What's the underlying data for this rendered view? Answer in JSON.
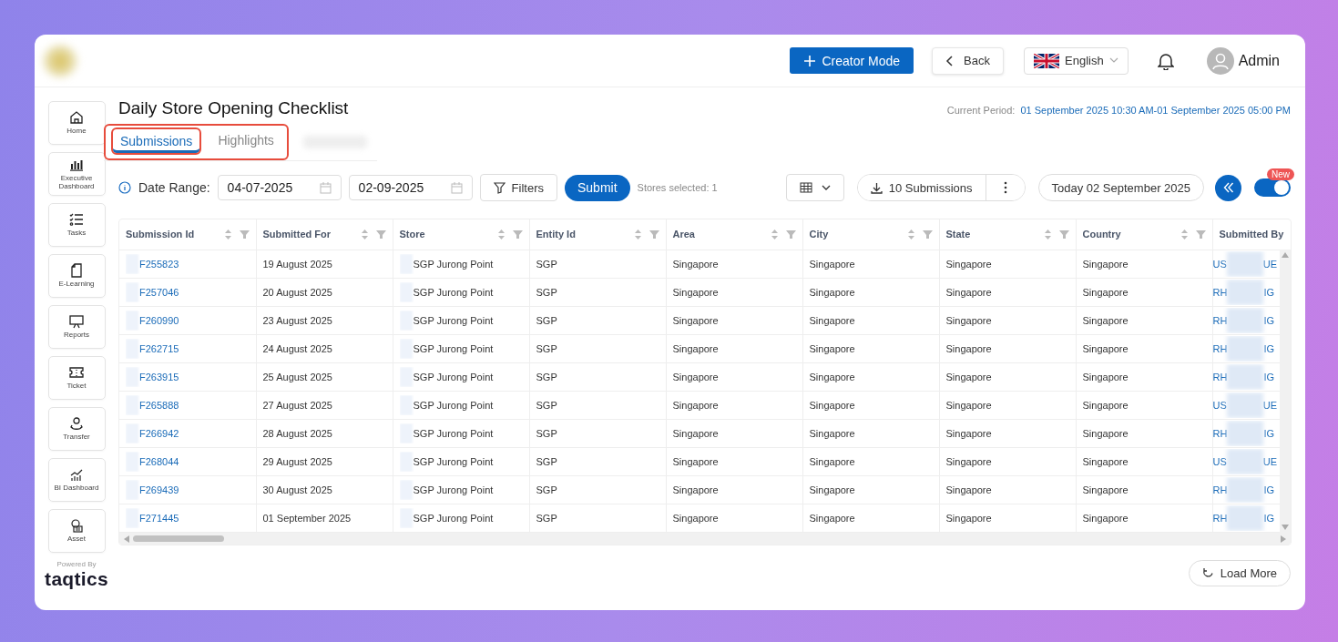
{
  "header": {
    "creator_button": "Creator Mode",
    "back_button": "Back",
    "language": "English",
    "user": "Admin"
  },
  "sidebar": {
    "items": [
      {
        "label": "Home"
      },
      {
        "label": "Executive Dashboard"
      },
      {
        "label": "Tasks"
      },
      {
        "label": "E-Learning"
      },
      {
        "label": "Reports"
      },
      {
        "label": "Ticket"
      },
      {
        "label": "Transfer"
      },
      {
        "label": "BI Dashboard"
      },
      {
        "label": "Asset"
      }
    ],
    "powered_by": "Powered By",
    "brand": "taqtics"
  },
  "page": {
    "title": "Daily Store Opening Checklist",
    "period_label": "Current Period:",
    "period_value": "01 September 2025 10:30 AM-01 September 2025 05:00 PM"
  },
  "tabs": [
    {
      "label": "Submissions",
      "selected": true
    },
    {
      "label": "Highlights",
      "selected": false
    }
  ],
  "toolbar": {
    "date_range_label": "Date Range:",
    "date_from": "04-07-2025",
    "date_to": "02-09-2025",
    "filters_button": "Filters",
    "submit_button": "Submit",
    "stores_selected": "Stores selected: 1",
    "export_button": "10 Submissions",
    "today_button": "Today 02 September 2025",
    "toggle": {
      "on": true,
      "badge": "New"
    }
  },
  "table": {
    "columns": [
      {
        "label": "Submission Id",
        "sortable": true
      },
      {
        "label": "Submitted For",
        "sortable": true
      },
      {
        "label": "Store",
        "sortable": true
      },
      {
        "label": "Entity Id",
        "sortable": true
      },
      {
        "label": "Area",
        "sortable": true
      },
      {
        "label": "City",
        "sortable": true
      },
      {
        "label": "State",
        "sortable": true
      },
      {
        "label": "Country",
        "sortable": true
      },
      {
        "label": "Submitted By"
      }
    ],
    "rows": [
      {
        "id": "F255823",
        "date": "19 August 2025",
        "store": "SGP Jurong Point",
        "entity": "SGP",
        "area": "Singapore",
        "city": "Singapore",
        "state": "Singapore",
        "country": "Singapore",
        "by_start": "US",
        "by_end": "UE"
      },
      {
        "id": "F257046",
        "date": "20 August 2025",
        "store": "SGP Jurong Point",
        "entity": "SGP",
        "area": "Singapore",
        "city": "Singapore",
        "state": "Singapore",
        "country": "Singapore",
        "by_start": "RH",
        "by_end": "IG"
      },
      {
        "id": "F260990",
        "date": "23 August 2025",
        "store": "SGP Jurong Point",
        "entity": "SGP",
        "area": "Singapore",
        "city": "Singapore",
        "state": "Singapore",
        "country": "Singapore",
        "by_start": "RH",
        "by_end": "IG"
      },
      {
        "id": "F262715",
        "date": "24 August 2025",
        "store": "SGP Jurong Point",
        "entity": "SGP",
        "area": "Singapore",
        "city": "Singapore",
        "state": "Singapore",
        "country": "Singapore",
        "by_start": "RH",
        "by_end": "IG"
      },
      {
        "id": "F263915",
        "date": "25 August 2025",
        "store": "SGP Jurong Point",
        "entity": "SGP",
        "area": "Singapore",
        "city": "Singapore",
        "state": "Singapore",
        "country": "Singapore",
        "by_start": "RH",
        "by_end": "IG"
      },
      {
        "id": "F265888",
        "date": "27 August 2025",
        "store": "SGP Jurong Point",
        "entity": "SGP",
        "area": "Singapore",
        "city": "Singapore",
        "state": "Singapore",
        "country": "Singapore",
        "by_start": "US",
        "by_end": "UE"
      },
      {
        "id": "F266942",
        "date": "28 August 2025",
        "store": "SGP Jurong Point",
        "entity": "SGP",
        "area": "Singapore",
        "city": "Singapore",
        "state": "Singapore",
        "country": "Singapore",
        "by_start": "RH",
        "by_end": "IG"
      },
      {
        "id": "F268044",
        "date": "29 August 2025",
        "store": "SGP Jurong Point",
        "entity": "SGP",
        "area": "Singapore",
        "city": "Singapore",
        "state": "Singapore",
        "country": "Singapore",
        "by_start": "US",
        "by_end": "UE"
      },
      {
        "id": "F269439",
        "date": "30 August 2025",
        "store": "SGP Jurong Point",
        "entity": "SGP",
        "area": "Singapore",
        "city": "Singapore",
        "state": "Singapore",
        "country": "Singapore",
        "by_start": "RH",
        "by_end": "IG"
      },
      {
        "id": "F271445",
        "date": "01 September 2025",
        "store": "SGP Jurong Point",
        "entity": "SGP",
        "area": "Singapore",
        "city": "Singapore",
        "state": "Singapore",
        "country": "Singapore",
        "by_start": "RH",
        "by_end": "IG"
      }
    ]
  },
  "load_more_button": "Load More"
}
